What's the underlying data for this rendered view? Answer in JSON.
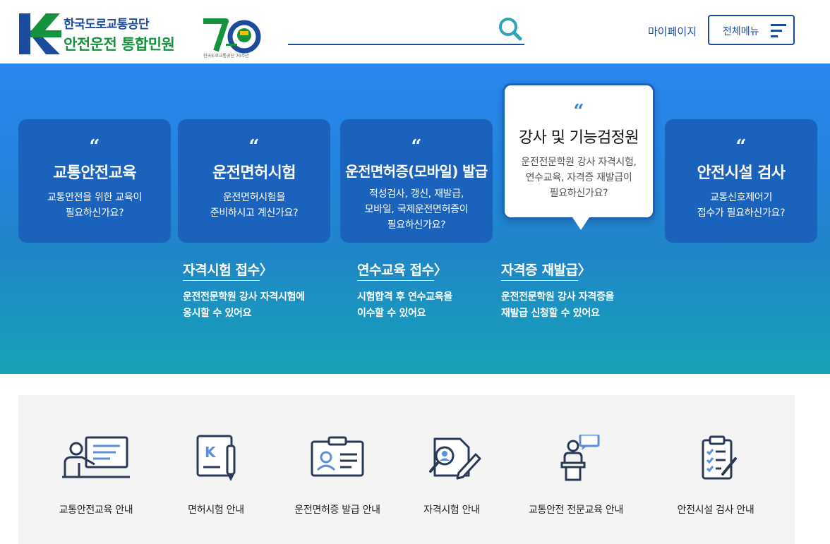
{
  "header": {
    "org_name": "한국도로교통공단",
    "site_name": "안전운전 통합민원",
    "anniversary_caption": "한국도로교통공단 70주년",
    "search": {
      "value": "",
      "placeholder": ""
    },
    "mypage_label": "마이페이지",
    "menu_label": "전체메뉴"
  },
  "hero": {
    "cards": [
      {
        "title": "교통안전교육",
        "desc": "교통안전을 위한 교육이\n필요하신가요?"
      },
      {
        "title": "운전면허시험",
        "desc": "운전면허시험을\n준비하시고 계신가요?"
      },
      {
        "title": "운전면허증(모바일) 발급",
        "desc": "적성검사, 갱신, 재발급,\n모바일, 국제운전면허증이\n필요하신가요?"
      },
      {
        "title": "강사 및 기능검정원",
        "desc": "운전전문학원 강사 자격시험,\n연수교육, 자격증 재발급이\n필요하신가요?",
        "active": true
      },
      {
        "title": "안전시설 검사",
        "desc": "교통신호제어기\n접수가 필요하신가요?"
      }
    ],
    "quote_mark": "“",
    "sub_links": [
      {
        "title": "자격시험 접수",
        "arrow": "〉",
        "desc": "운전전문학원 강사 자격시험에\n응시할 수 있어요"
      },
      {
        "title": "연수교육 접수",
        "arrow": "〉",
        "desc": "시험합격 후 연수교육을\n이수할 수 있어요"
      },
      {
        "title": "자격증 재발급",
        "arrow": "〉",
        "desc": "운전전문학원 강사 자격증을\n재발급 신청할 수 있어요"
      }
    ]
  },
  "quick_menu": [
    {
      "label": "교통안전교육 안내",
      "icon": "teacher-board-icon"
    },
    {
      "label": "면허시험 안내",
      "icon": "license-exam-icon"
    },
    {
      "label": "운전면허증 발급 안내",
      "icon": "id-card-icon"
    },
    {
      "label": "자격시험 안내",
      "icon": "certificate-exam-icon"
    },
    {
      "label": "교통안전 전문교육 안내",
      "icon": "lecturer-podium-icon"
    },
    {
      "label": "안전시설 검사 안내",
      "icon": "checklist-clipboard-icon"
    }
  ],
  "colors": {
    "brand_blue": "#1d4b9c",
    "brand_green": "#14923c",
    "card_blue": "#1b62bd",
    "hero_top": "#2a86ee",
    "hero_bottom": "#17a3b7"
  }
}
